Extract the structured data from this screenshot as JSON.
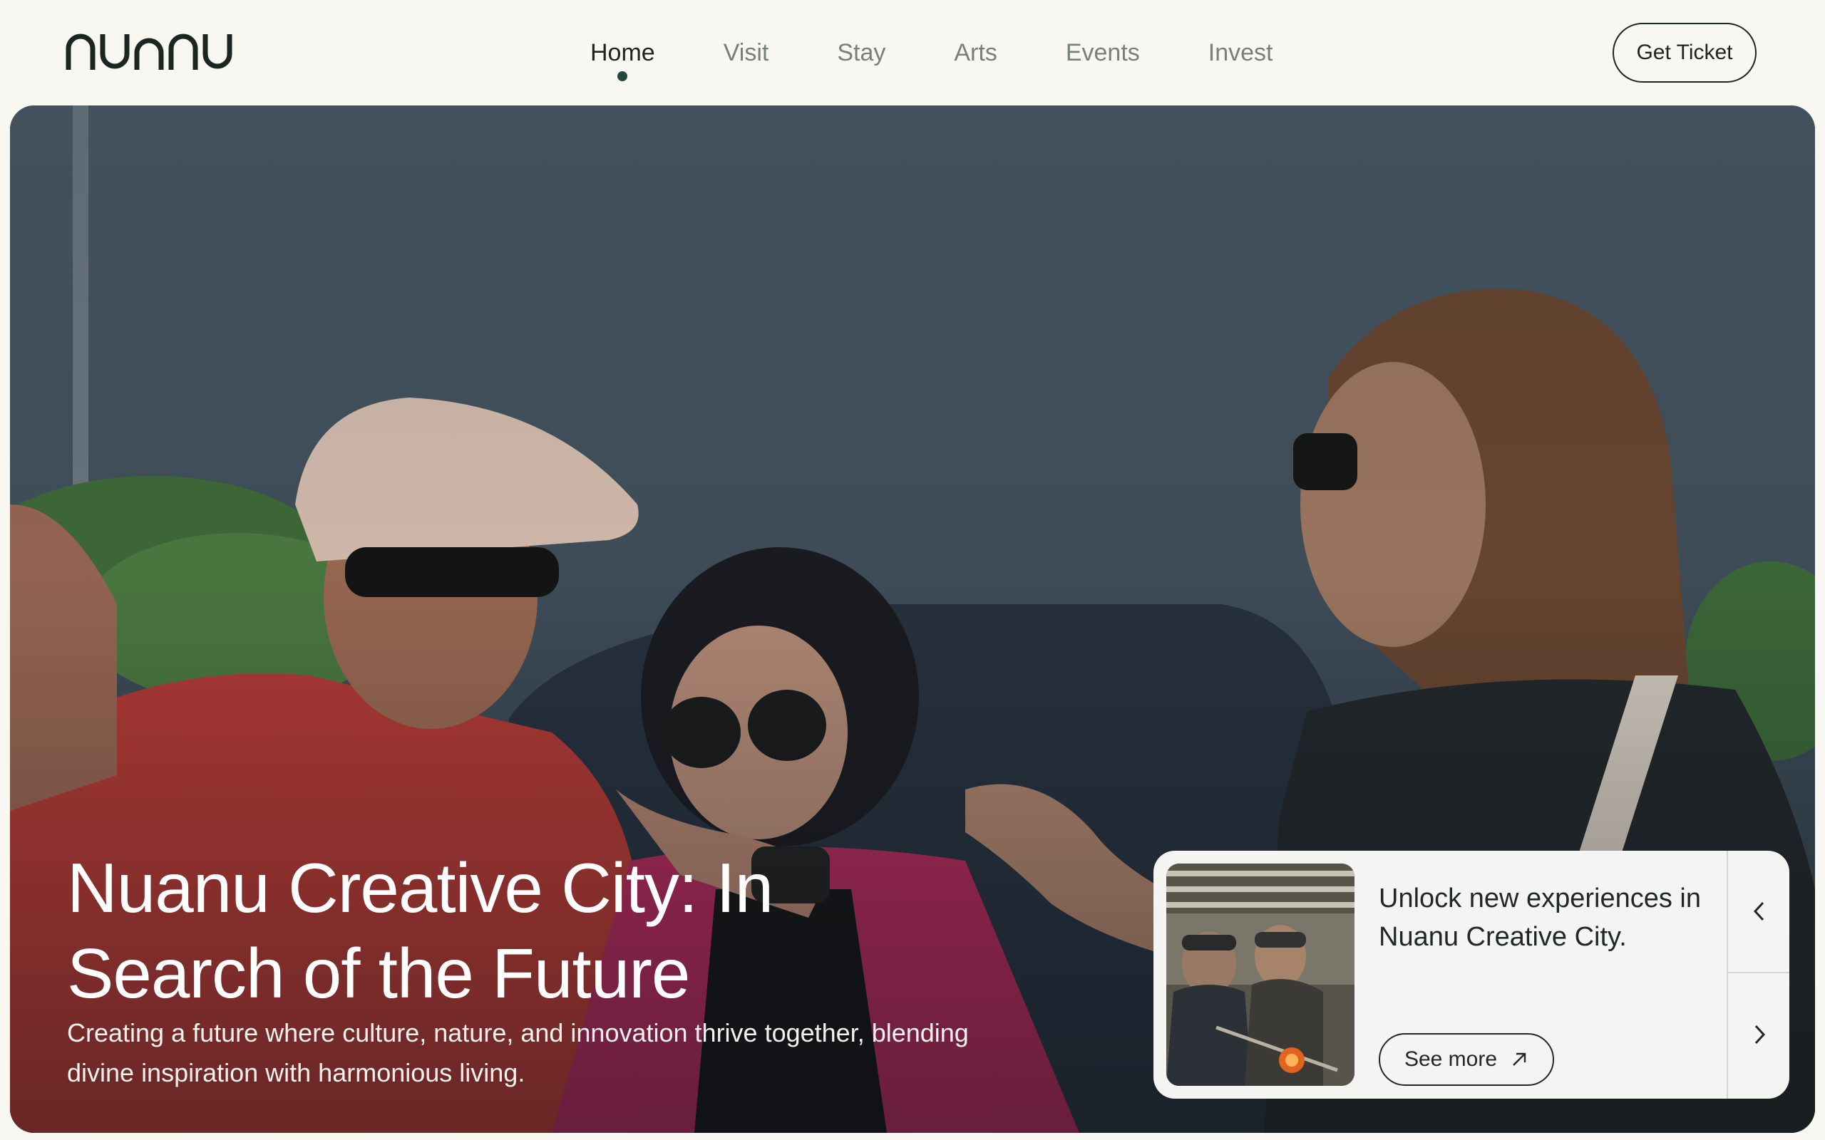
{
  "brand": {
    "logo_text": "nuanu"
  },
  "nav": {
    "items": [
      {
        "label": "Home",
        "active": true
      },
      {
        "label": "Visit",
        "active": false
      },
      {
        "label": "Stay",
        "active": false
      },
      {
        "label": "Arts",
        "active": false
      },
      {
        "label": "Events",
        "active": false
      },
      {
        "label": "Invest",
        "active": false
      }
    ],
    "cta_label": "Get Ticket"
  },
  "hero": {
    "title": "Nuanu Creative City: In Search of the Future",
    "subtitle": "Creating a future where culture, nature, and innovation thrive together, blending divine inspiration with harmonious living."
  },
  "promo": {
    "text": "Unlock new experiences in Nuanu Creative City.",
    "button_label": "See more",
    "button_icon": "arrow-up-right-icon",
    "prev_icon": "chevron-left-icon",
    "next_icon": "chevron-right-icon"
  },
  "colors": {
    "page_bg": "#f9f7f2",
    "text_dark": "#1b2622",
    "nav_inactive": "#77807b",
    "active_dot": "#1f4a3d",
    "card_bg": "#f4f4f3"
  }
}
